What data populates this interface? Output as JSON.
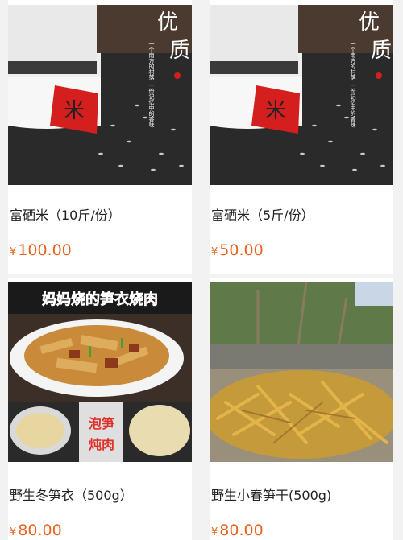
{
  "products": [
    {
      "title": "富硒米（10斤/份）",
      "currency": "¥",
      "price": "100.00",
      "image": {
        "icon": "rice-jar-image",
        "headline_1": "优",
        "headline_2": "质",
        "tagline": "一个南方的村落 一份记忆中的香味",
        "jar_label": "米"
      }
    },
    {
      "title": "富硒米（5斤/份）",
      "currency": "¥",
      "price": "50.00",
      "image": {
        "icon": "rice-jar-image",
        "headline_1": "优",
        "headline_2": "质",
        "tagline": "一个南方的村落 一份记忆中的香味",
        "jar_label": "米"
      }
    },
    {
      "title": "野生冬笋衣（500g）",
      "currency": "¥",
      "price": "80.00",
      "image": {
        "icon": "bamboo-shoot-dish-image",
        "banner": "妈妈烧的笋衣烧肉",
        "caption_1": "泡笋",
        "caption_2": "炖肉"
      }
    },
    {
      "title": "野生小春笋干(500g)",
      "currency": "¥",
      "price": "80.00",
      "image": {
        "icon": "dried-bamboo-shoots-image"
      }
    }
  ],
  "colors": {
    "price": "#e8621f",
    "background": "#f2f2f2",
    "banner_text": "#e83a2e",
    "caption_text": "#e0302a"
  }
}
